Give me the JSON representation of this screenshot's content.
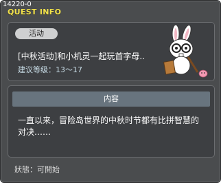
{
  "window": {
    "quest_id": "14220-0",
    "title": "QUEST INFO"
  },
  "quest": {
    "tag": "活动",
    "name": "[中秋活动]和小机灵一起玩首字母..",
    "level": "建议等级：13～17"
  },
  "content": {
    "header": "内容",
    "text": "一直以来，冒险岛世界的中秋时节都有比拼智慧的对决……"
  },
  "status": "狀態：可開始",
  "colors": {
    "title": "#f2e24b",
    "window_bg": "#4a4c4e",
    "panel_bg": "#3d3f42",
    "header_bar": "#68747e"
  },
  "icons": {
    "mascot": "rabbit-with-glasses-icon",
    "small_pet": "pink-slime-icon"
  }
}
